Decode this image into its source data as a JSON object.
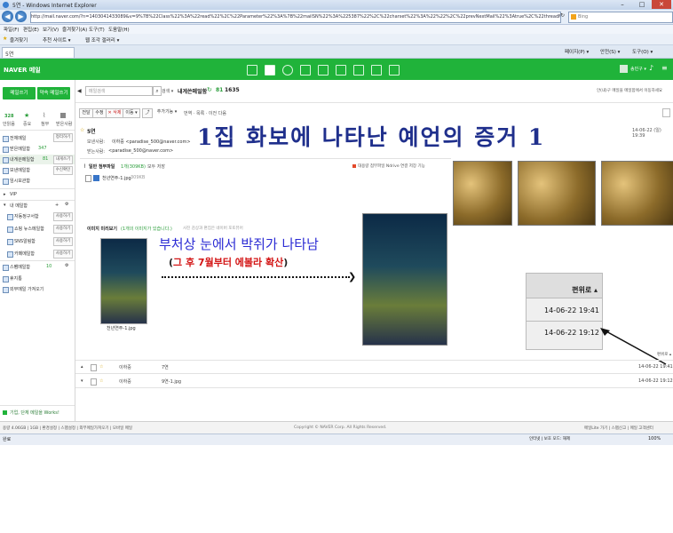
{
  "browser": {
    "window_title": "5연 - Windows Internet Explorer",
    "url": "http://mail.naver.com/?n=1403041433089&v=9%7B%22Class%22%3A%22read%22%2C%22Parameter%22%3A%7B%22mailSN%22%3A%225387%22%2C%22charset%22%3A%22%22%2C%22prevNextMail%22%3Atrue%2C%22threadMail%22%3Atrue%2C%22",
    "search_engine": "Bing",
    "menu": [
      "파일(F)",
      "편집(E)",
      "보기(V)",
      "즐겨찾기(A)",
      "도구(T)",
      "도움말(H)"
    ],
    "favorites_label": "즐겨찾기",
    "favorites_links": [
      "추천 사이트 ▾",
      "웹 조각 갤러리 ▾"
    ],
    "tab_title": "5연",
    "toolbar_right": [
      "페이지(P) ▾",
      "안전(S) ▾",
      "도구(O) ▾"
    ],
    "status_left": "완료",
    "status_right": "인터넷 | 보호 모드: 해제",
    "zoom": "100%"
  },
  "naver": {
    "logo": "NAVER 메일",
    "user": "송민구 ▾"
  },
  "sidebar": {
    "write_button": "메일쓰기",
    "write_me_button": "약속 메일쓰기",
    "stats": [
      {
        "count": "328",
        "label": "안읽음"
      },
      {
        "count": "",
        "label": "중요"
      },
      {
        "count": "",
        "label": "첨부"
      },
      {
        "count": "",
        "label": "받은사람"
      }
    ],
    "folders": [
      {
        "label": "전체메일",
        "count": "",
        "badge": "정리하기"
      },
      {
        "label": "받은메일함",
        "count": "347",
        "badge": ""
      },
      {
        "label": "내게쓴메일함",
        "count": "81",
        "badge": "내게쓰기"
      },
      {
        "label": "보낸메일함",
        "count": "",
        "badge": "수신확인"
      },
      {
        "label": "임시보관함",
        "count": "",
        "badge": ""
      }
    ],
    "vip_label": "VIP",
    "my_folders_label": "내 메일함",
    "my_folders": [
      {
        "label": "자동정구서함",
        "badge": "사용하기"
      },
      {
        "label": "쇼핑 뉴스메일함",
        "badge": "사용하기"
      },
      {
        "label": "SNS알림함",
        "badge": "사용하기"
      },
      {
        "label": "카페메일함",
        "badge": "사용하기"
      }
    ],
    "spam_label": "스팸메일함",
    "spam_count": "10",
    "trash_label": "휴지통",
    "external_label": "외부메일 가져오기",
    "bottom_promo": "기업, 단체 메일을 Works!"
  },
  "mail": {
    "search_placeholder": "메일검색",
    "search_button": "검색 ▾",
    "folder_title": "내게쓴메일함",
    "folder_count": "81",
    "folder_total": "1635",
    "toolbar_buttons": [
      "전달",
      "수정",
      "✕ 삭제",
      "이동 ▾",
      "⤴",
      "추가기능 ▾"
    ],
    "view_label": "번역 · 목록 · 이전 다음",
    "header_right": "안(내)구 메일을 메일함에서 이동하세요",
    "subject": "5연",
    "from_label": "보낸사람:",
    "from_value": "이하중 <paradise_500@naver.com>",
    "to_label": "받는사람:",
    "to_value": "<paradise_500@naver.com>",
    "date": "14-06-22 (일) 19:39",
    "attach_title": "일반 첨부파일",
    "attach_count": "1개(309KB)",
    "attach_save": "모두 저장",
    "attach_right": "대용량 첨부파일 Ndrive 연결 저장 기능",
    "attach_file": "천년연주-1.jpg",
    "attach_size": "309KB",
    "preview_label": "이미지 미리보기",
    "preview_note": "(1개의 이미지가 있습니다.)",
    "preview_link": "사진 감상과 편집은 네이버 포토뷰어",
    "thumb_caption": "천년연주-1.jpg",
    "list_rows": [
      {
        "from": "이하중",
        "subject": "7연",
        "date": "14-06-22 19:41"
      },
      {
        "from": "이하중",
        "subject": "9연-1.jpg",
        "date": "14-06-22 19:12"
      }
    ],
    "footer": "Copyright © NAVER Corp. All Rights Reserved.",
    "footer_left": "용량 4.06GB | 1GB | 환경설정 | 스팸설정 | 외부메일가져오기 | 모바일 메일",
    "footer_right": "메일Lite 가기 | 스팸신고 | 메일 고객센터"
  },
  "annotations": {
    "big_title": "1집 화보에 나타난 예언의 증거 1",
    "blue_text": "부처상 눈에서 박쥐가 나타남",
    "red_paren_open": "(",
    "red_text": "그 후 7월부터 에볼라 확산",
    "red_paren_close": ")",
    "zoom_header": "편위로 ▴",
    "zoom_row1": "14-06-22 19:41",
    "zoom_row2": "14-06-22 19:12"
  }
}
